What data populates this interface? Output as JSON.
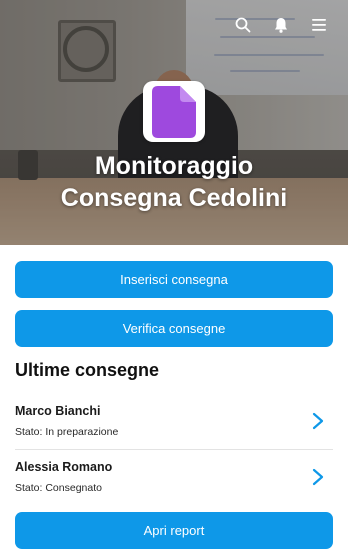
{
  "header": {
    "title_line1": "Monitoraggio",
    "title_line2": "Consegna Cedolini",
    "icons": [
      "search-icon",
      "bell-icon",
      "menu-icon",
      "document-icon"
    ]
  },
  "actions": {
    "insert_label": "Inserisci consegna",
    "verify_label": "Verifica consegne",
    "report_label": "Apri report"
  },
  "recent": {
    "title": "Ultime consegne",
    "items": [
      {
        "name": "Marco Bianchi",
        "status": "Stato: In preparazione"
      },
      {
        "name": "Alessia Romano",
        "status": "Stato: Consegnato"
      }
    ]
  },
  "colors": {
    "accent": "#0e98e8",
    "logo": "#9e49de",
    "chevron": "#0e98e8"
  }
}
